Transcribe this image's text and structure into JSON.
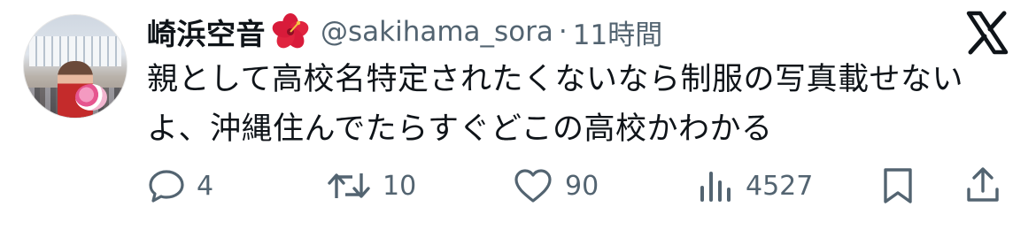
{
  "user": {
    "display_name": "崎浜空音",
    "handle": "@sakihama_sora",
    "separator": "·",
    "time": "11時間",
    "emoji": "hibiscus-icon"
  },
  "tweet": {
    "lines": [
      "親として高校名特定されたくないなら制服の写真載せない",
      "よ、沖縄住んでたらすぐどこの高校かわかる"
    ]
  },
  "actions": {
    "reply_count": "4",
    "retweet_count": "10",
    "like_count": "90",
    "view_count": "4527"
  },
  "colors": {
    "text": "#0f1419",
    "secondary": "#536471",
    "background": "#ffffff"
  },
  "icons": [
    "reply-icon",
    "retweet-icon",
    "like-icon",
    "views-icon",
    "bookmark-icon",
    "share-icon",
    "x-logo-icon"
  ]
}
